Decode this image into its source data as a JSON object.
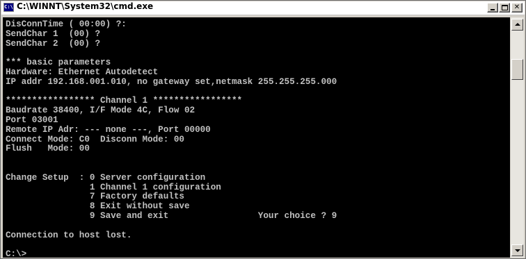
{
  "window": {
    "title": "C:\\WINNT\\System32\\cmd.exe",
    "app_icon_text": "C:\\"
  },
  "caption_buttons": {
    "minimize": "minimize",
    "maximize": "maximize",
    "close": "✕"
  },
  "console": {
    "text": "DisConnTime ( 00:00) ?:\nSendChar 1  (00) ?\nSendChar 2  (00) ?\n\n*** basic parameters\nHardware: Ethernet Autodetect\nIP addr 192.168.001.010, no gateway set,netmask 255.255.255.000\n\n***************** Channel 1 *****************\nBaudrate 38400, I/F Mode 4C, Flow 02\nPort 03001\nRemote IP Adr: --- none ---, Port 00000\nConnect Mode: C0  Disconn Mode: 00\nFlush   Mode: 00\n\n\nChange Setup  : 0 Server configuration\n                1 Channel 1 configuration\n                7 Factory defaults\n                8 Exit without save\n                9 Save and exit                 Your choice ? 9\n\nConnection to host lost.\n\nC:\\>",
    "text_color": "#c0c0c0",
    "background_color": "#000000"
  }
}
